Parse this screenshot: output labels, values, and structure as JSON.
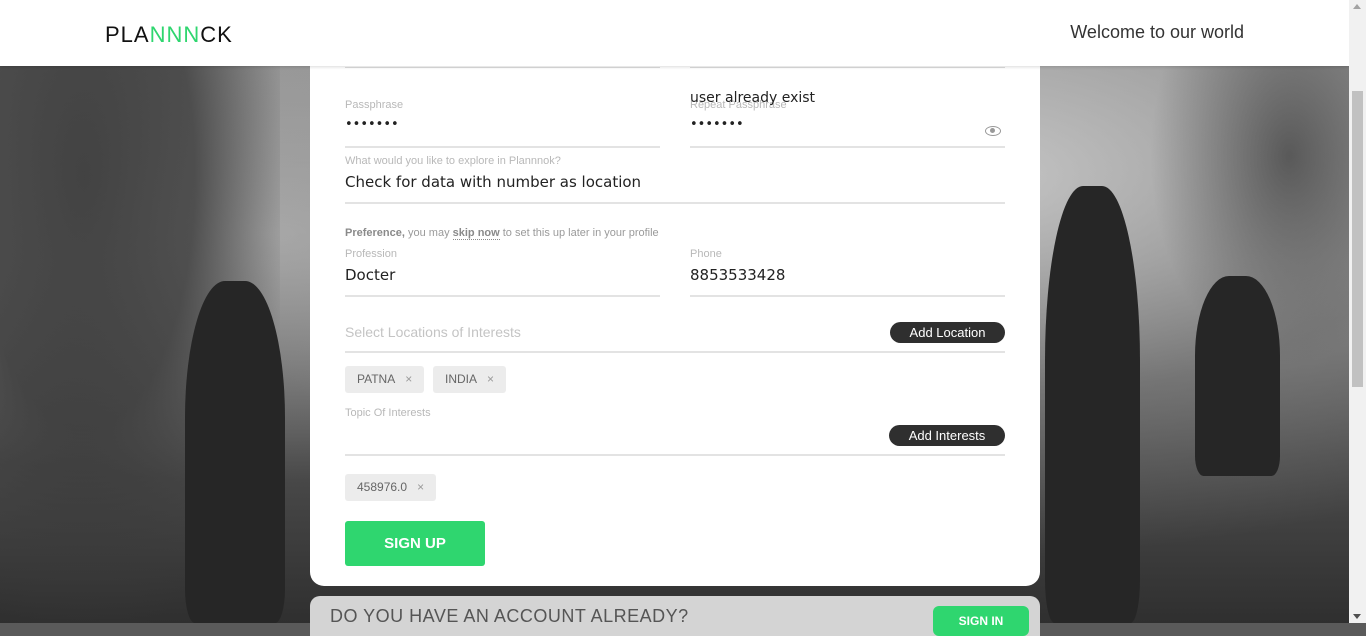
{
  "header": {
    "logo_left": "PLA",
    "logo_mid": "NNN",
    "logo_right": "CK",
    "welcome": "Welcome to our world"
  },
  "form": {
    "passphrase_label": "Passphrase",
    "passphrase_value": "•••••••",
    "repeat_passphrase_label": "Repeat Passphrase",
    "repeat_passphrase_value": "•••••••",
    "error_text": "user already exist",
    "explore_label": "What would you like to explore in Plannnok?",
    "explore_value": "Check for data with number as location",
    "preference_bold": "Preference,",
    "preference_text_1": " you may ",
    "preference_skip": "skip now",
    "preference_text_2": " to set this up later in your profile",
    "profession_label": "Profession",
    "profession_value": "Docter",
    "phone_label": "Phone",
    "phone_value": "8853533428",
    "locations_placeholder": "Select Locations of Interests",
    "add_location_label": "Add Location",
    "location_chips": [
      "PATNA",
      "INDIA"
    ],
    "topic_label": "Topic Of Interests",
    "add_interests_label": "Add Interests",
    "interest_chips": [
      "458976.0"
    ],
    "chip_close": "×",
    "signup_label": "SIGN UP"
  },
  "bottom_bar": {
    "text": "DO YOU HAVE AN ACCOUNT ALREADY?",
    "signin_label": "SIGN IN"
  },
  "icons": {
    "eye": "eye-icon"
  },
  "colors": {
    "accent": "#2fd66f",
    "dark_button": "#2f2f2f"
  }
}
